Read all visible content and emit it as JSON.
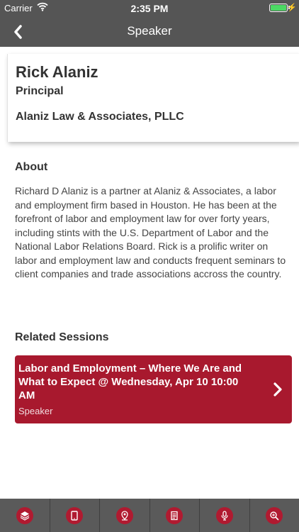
{
  "status_bar": {
    "carrier": "Carrier",
    "time": "2:35 PM",
    "battery_level": 1.0,
    "battery_color": "#4cd964"
  },
  "nav": {
    "title": "Speaker",
    "back_icon": "chevron-left-icon"
  },
  "speaker": {
    "name": "Rick Alaniz",
    "title": "Principal",
    "company": "Alaniz Law & Associates, PLLC"
  },
  "about": {
    "heading": "About",
    "text": "Richard D Alaniz is a partner at Alaniz & Associates, a labor and employment firm based in Houston. He has been at the forefront of labor and employment law for over forty years, including stints with the U.S. Department of Labor and the National Labor Relations Board. Rick is a prolific writer on labor and employment law and conducts frequent seminars to client companies and trade associations accross the country."
  },
  "related": {
    "heading": "Related Sessions",
    "sessions": [
      {
        "title": "Labor and Employment – Where We Are and What to Expect @ Wednesday, Apr 10 10:00 AM",
        "role": "Speaker"
      }
    ]
  },
  "tab_bar": {
    "tabs": [
      {
        "icon": "layers-icon"
      },
      {
        "icon": "tablet-icon"
      },
      {
        "icon": "map-pin-icon"
      },
      {
        "icon": "document-icon"
      },
      {
        "icon": "microphone-icon"
      },
      {
        "icon": "zoom-search-icon"
      }
    ]
  },
  "colors": {
    "header": "#555555",
    "accent": "#a8192e",
    "tab_bar": "#5a5a5a"
  }
}
